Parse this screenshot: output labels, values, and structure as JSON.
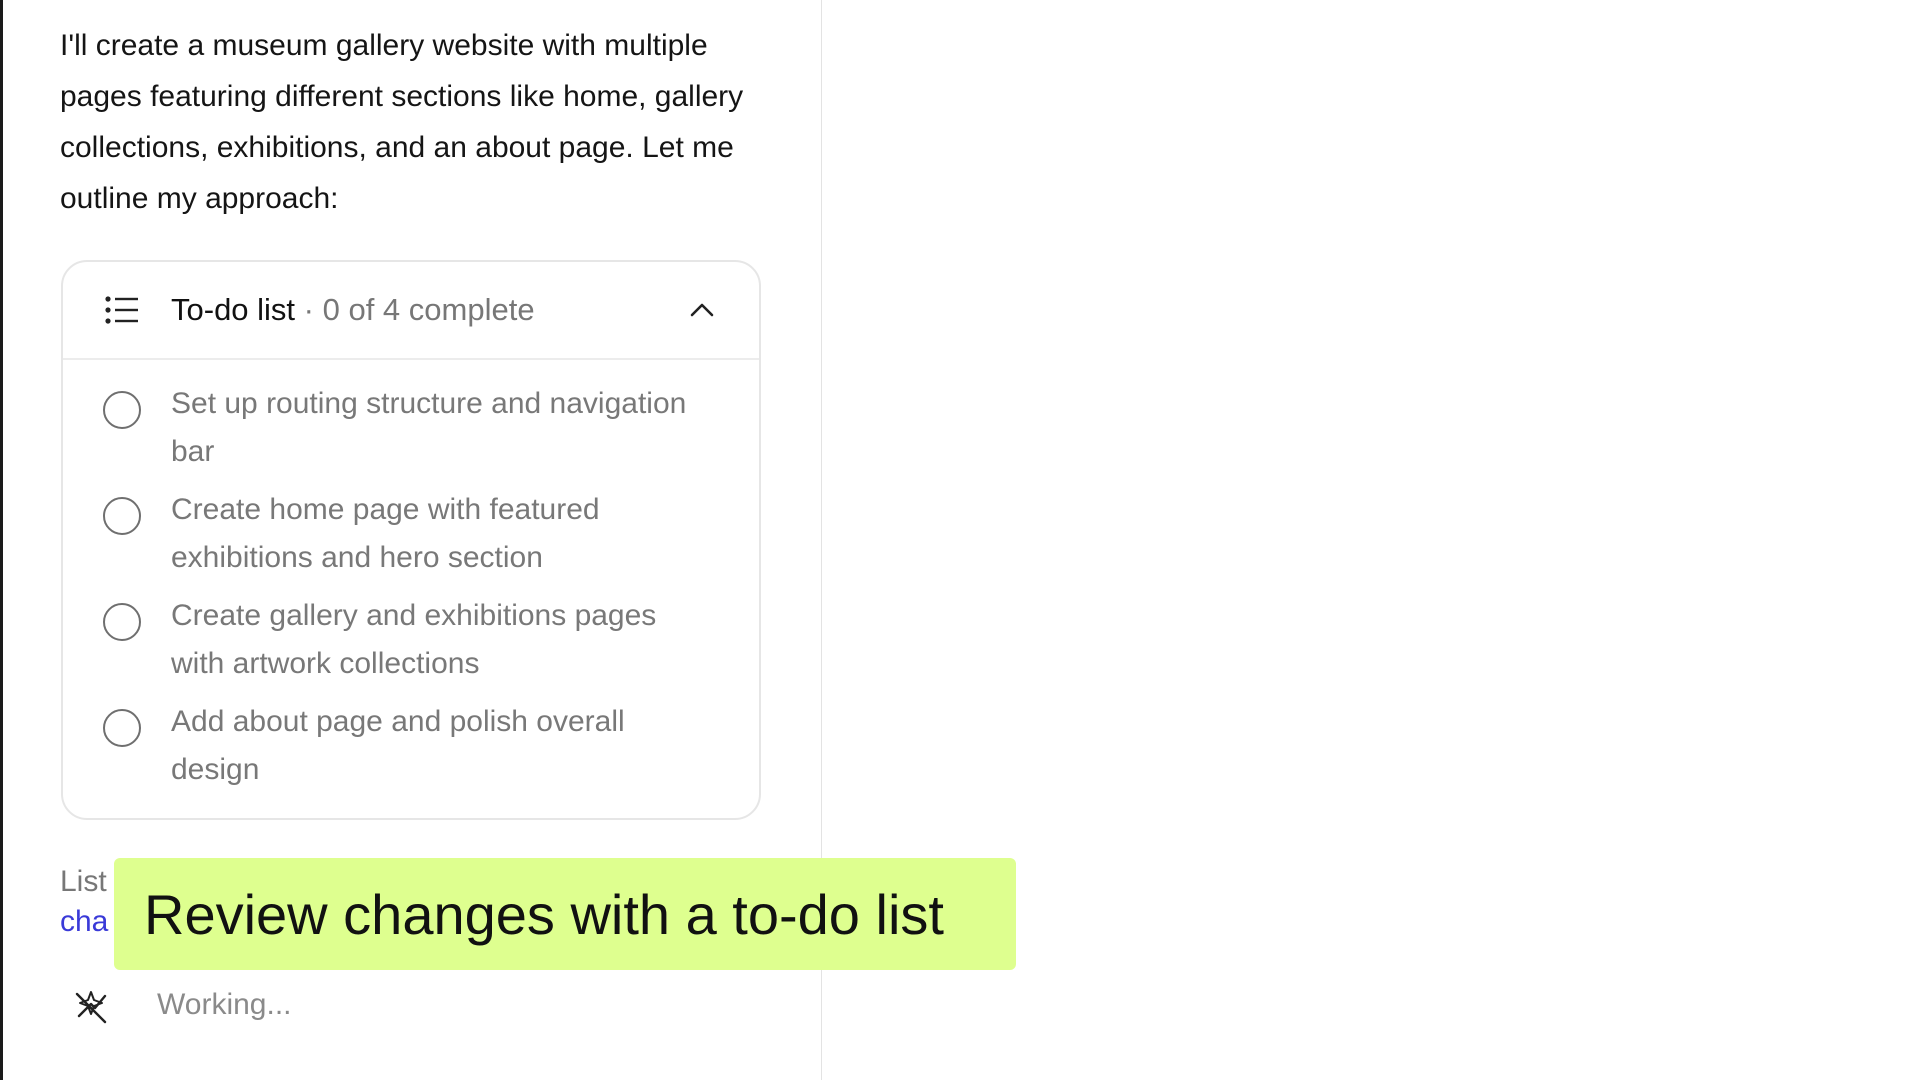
{
  "intro_text": "I'll create a museum gallery website with multiple pages featuring different sections like home, gallery collections, exhibitions, and an about page. Let me outline my approach:",
  "todo": {
    "title": "To-do list",
    "separator": " · ",
    "progress": "0 of 4 complete",
    "icon": "list-icon",
    "toggle_icon": "chevron-up-icon",
    "items": [
      {
        "label": "Set up routing structure and navigation bar",
        "done": false
      },
      {
        "label": "Create home page with featured exhibitions and hero section",
        "done": false
      },
      {
        "label": "Create gallery and exhibitions pages with artwork collections",
        "done": false
      },
      {
        "label": "Add about page and polish overall design",
        "done": false
      }
    ]
  },
  "partial": {
    "line1": "List",
    "link": "cha"
  },
  "status": {
    "icon": "working-icon",
    "text": "Working..."
  },
  "caption": "Review changes with a to-do list",
  "colors": {
    "caption_bg": "#deff8f",
    "link": "#3a3ad8"
  }
}
